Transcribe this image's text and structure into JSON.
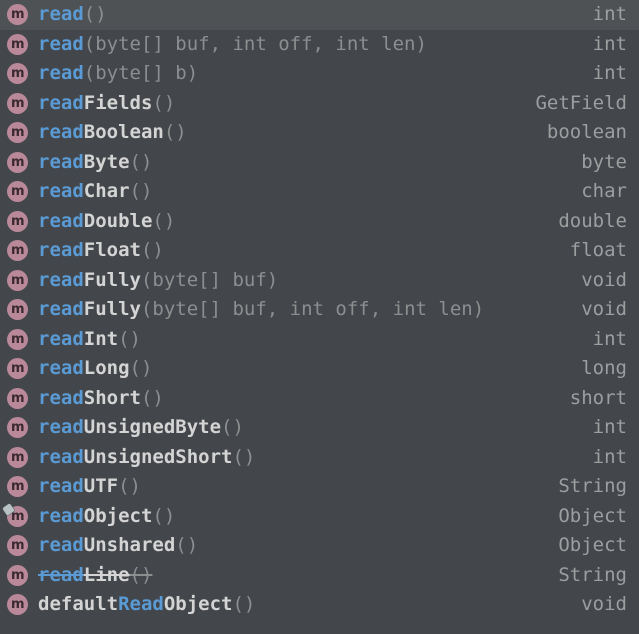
{
  "popup": {
    "kind": "code-completion-popup",
    "icon_label": "m",
    "icon_semantic": "method-icon",
    "colors": {
      "background": "#43464a",
      "selected_background": "#4e5254",
      "method_icon": "#b9899a",
      "match_prefix": "#5b9bd5",
      "identifier": "#d4d4d4",
      "params": "#8b8f90",
      "return_type": "#9b9fa0"
    },
    "items": [
      {
        "match": "read",
        "rest": "",
        "params": "()",
        "type": "int",
        "selected": true,
        "deprecated": false,
        "overridden": false
      },
      {
        "match": "read",
        "rest": "",
        "params": "(byte[] buf, int off, int len)",
        "type": "int",
        "selected": false,
        "deprecated": false,
        "overridden": false
      },
      {
        "match": "read",
        "rest": "",
        "params": "(byte[] b)",
        "type": "int",
        "selected": false,
        "deprecated": false,
        "overridden": false
      },
      {
        "match": "read",
        "rest": "Fields",
        "params": "()",
        "type": "GetField",
        "selected": false,
        "deprecated": false,
        "overridden": false
      },
      {
        "match": "read",
        "rest": "Boolean",
        "params": "()",
        "type": "boolean",
        "selected": false,
        "deprecated": false,
        "overridden": false
      },
      {
        "match": "read",
        "rest": "Byte",
        "params": "()",
        "type": "byte",
        "selected": false,
        "deprecated": false,
        "overridden": false
      },
      {
        "match": "read",
        "rest": "Char",
        "params": "()",
        "type": "char",
        "selected": false,
        "deprecated": false,
        "overridden": false
      },
      {
        "match": "read",
        "rest": "Double",
        "params": "()",
        "type": "double",
        "selected": false,
        "deprecated": false,
        "overridden": false
      },
      {
        "match": "read",
        "rest": "Float",
        "params": "()",
        "type": "float",
        "selected": false,
        "deprecated": false,
        "overridden": false
      },
      {
        "match": "read",
        "rest": "Fully",
        "params": "(byte[] buf)",
        "type": "void",
        "selected": false,
        "deprecated": false,
        "overridden": false
      },
      {
        "match": "read",
        "rest": "Fully",
        "params": "(byte[] buf, int off, int len)",
        "type": "void",
        "selected": false,
        "deprecated": false,
        "overridden": false
      },
      {
        "match": "read",
        "rest": "Int",
        "params": "()",
        "type": "int",
        "selected": false,
        "deprecated": false,
        "overridden": false
      },
      {
        "match": "read",
        "rest": "Long",
        "params": "()",
        "type": "long",
        "selected": false,
        "deprecated": false,
        "overridden": false
      },
      {
        "match": "read",
        "rest": "Short",
        "params": "()",
        "type": "short",
        "selected": false,
        "deprecated": false,
        "overridden": false
      },
      {
        "match": "read",
        "rest": "UnsignedByte",
        "params": "()",
        "type": "int",
        "selected": false,
        "deprecated": false,
        "overridden": false
      },
      {
        "match": "read",
        "rest": "UnsignedShort",
        "params": "()",
        "type": "int",
        "selected": false,
        "deprecated": false,
        "overridden": false
      },
      {
        "match": "read",
        "rest": "UTF",
        "params": "()",
        "type": "String",
        "selected": false,
        "deprecated": false,
        "overridden": false
      },
      {
        "match": "read",
        "rest": "Object",
        "params": "()",
        "type": "Object",
        "selected": false,
        "deprecated": false,
        "overridden": true
      },
      {
        "match": "read",
        "rest": "Unshared",
        "params": "()",
        "type": "Object",
        "selected": false,
        "deprecated": false,
        "overridden": false
      },
      {
        "match": "read",
        "rest": "Line",
        "params": "()",
        "type": "String",
        "selected": false,
        "deprecated": true,
        "overridden": false
      },
      {
        "match": "",
        "rest_before": "default",
        "rest": "Object",
        "match_mid": "Read",
        "params": "()",
        "type": "void",
        "selected": false,
        "deprecated": false,
        "overridden": false,
        "split": true
      }
    ]
  }
}
